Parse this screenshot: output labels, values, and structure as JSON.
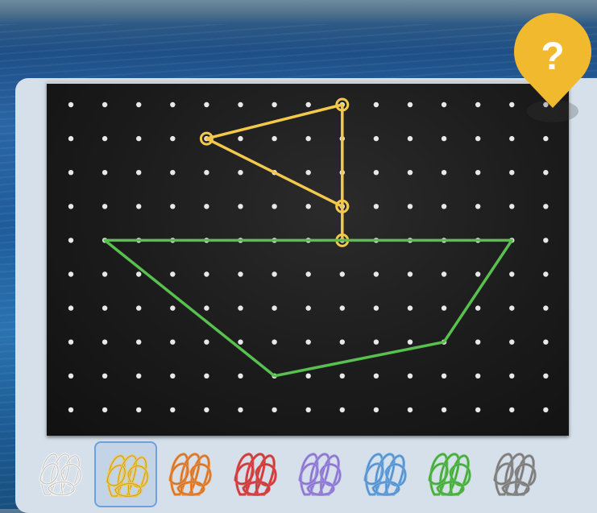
{
  "app": {
    "help_symbol": "?"
  },
  "board": {
    "cols": 15,
    "rows": 10,
    "peg_color": "#e8e8e8",
    "background": "#1b1b1b"
  },
  "shapes": [
    {
      "name": "sail",
      "color": "#f2c94c",
      "closed": true,
      "points": [
        [
          8,
          0
        ],
        [
          4,
          1
        ],
        [
          8,
          3
        ]
      ],
      "ringed_pegs": true
    },
    {
      "name": "mast",
      "color": "#f2c94c",
      "closed": false,
      "points": [
        [
          8,
          3
        ],
        [
          8,
          4
        ]
      ],
      "ringed_pegs": true
    },
    {
      "name": "hull",
      "color": "#58c04e",
      "closed": true,
      "points": [
        [
          1,
          4
        ],
        [
          13,
          4
        ],
        [
          11,
          7
        ],
        [
          6,
          8
        ]
      ],
      "ringed_pegs": false
    }
  ],
  "band_palette": [
    {
      "id": "white",
      "color": "#f2f2f2",
      "selected": false
    },
    {
      "id": "yellow",
      "color": "#f2c94c",
      "selected": true
    },
    {
      "id": "orange",
      "color": "#ef8a3a",
      "selected": false
    },
    {
      "id": "red",
      "color": "#e24a4a",
      "selected": false
    },
    {
      "id": "purple",
      "color": "#a08be6",
      "selected": false
    },
    {
      "id": "blue",
      "color": "#6aa8e6",
      "selected": false
    },
    {
      "id": "green",
      "color": "#58c04e",
      "selected": false
    },
    {
      "id": "gray",
      "color": "#8f8f8f",
      "selected": false
    }
  ],
  "colors": {
    "help_marker": "#f0b92e",
    "selected_outline": "#6fa0de"
  }
}
